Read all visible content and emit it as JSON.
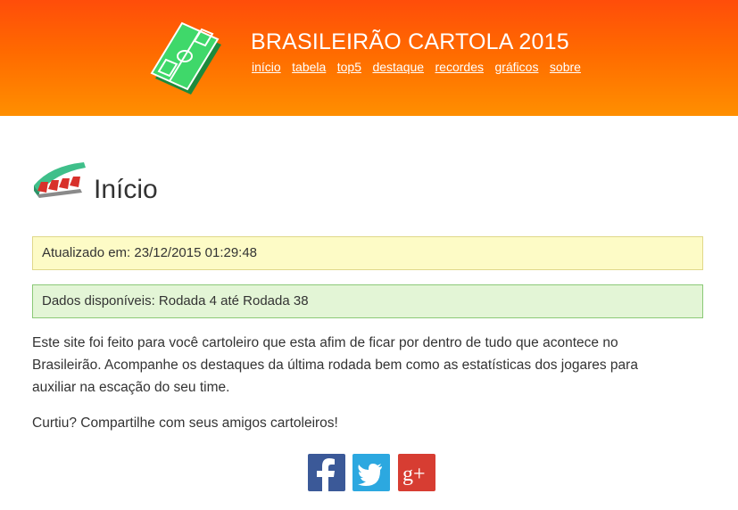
{
  "header": {
    "title": "BRASILEIRÃO CARTOLA 2015",
    "logo_icon": "soccer-field-icon",
    "nav": [
      {
        "label": "início"
      },
      {
        "label": "tabela"
      },
      {
        "label": "top5"
      },
      {
        "label": "destaque"
      },
      {
        "label": "recordes"
      },
      {
        "label": "gráficos"
      },
      {
        "label": "sobre"
      }
    ],
    "colors": {
      "gradient_top": "#ff4d0a",
      "gradient_bottom": "#ff8f00"
    }
  },
  "page": {
    "heading_icon": "stadium-seats-icon",
    "title": "Início",
    "updated": "Atualizado em: 23/12/2015 01:29:48",
    "data_range": "Dados disponíveis: Rodada 4 até Rodada 38",
    "intro": "Este site foi feito para você cartoleiro que esta afim de ficar por dentro de tudo que acontece no Brasileirão. Acompanhe os destaques da última rodada bem como as estatísticas dos jogares para auxiliar na escação do seu time.",
    "cta": "Curtiu? Compartilhe com seus amigos cartoleiros!"
  },
  "share": {
    "facebook_icon": "facebook-icon",
    "twitter_icon": "twitter-icon",
    "googleplus_icon": "google-plus-icon",
    "colors": {
      "facebook": "#3b5998",
      "twitter": "#2ca8e0",
      "googleplus": "#d73d32"
    }
  }
}
